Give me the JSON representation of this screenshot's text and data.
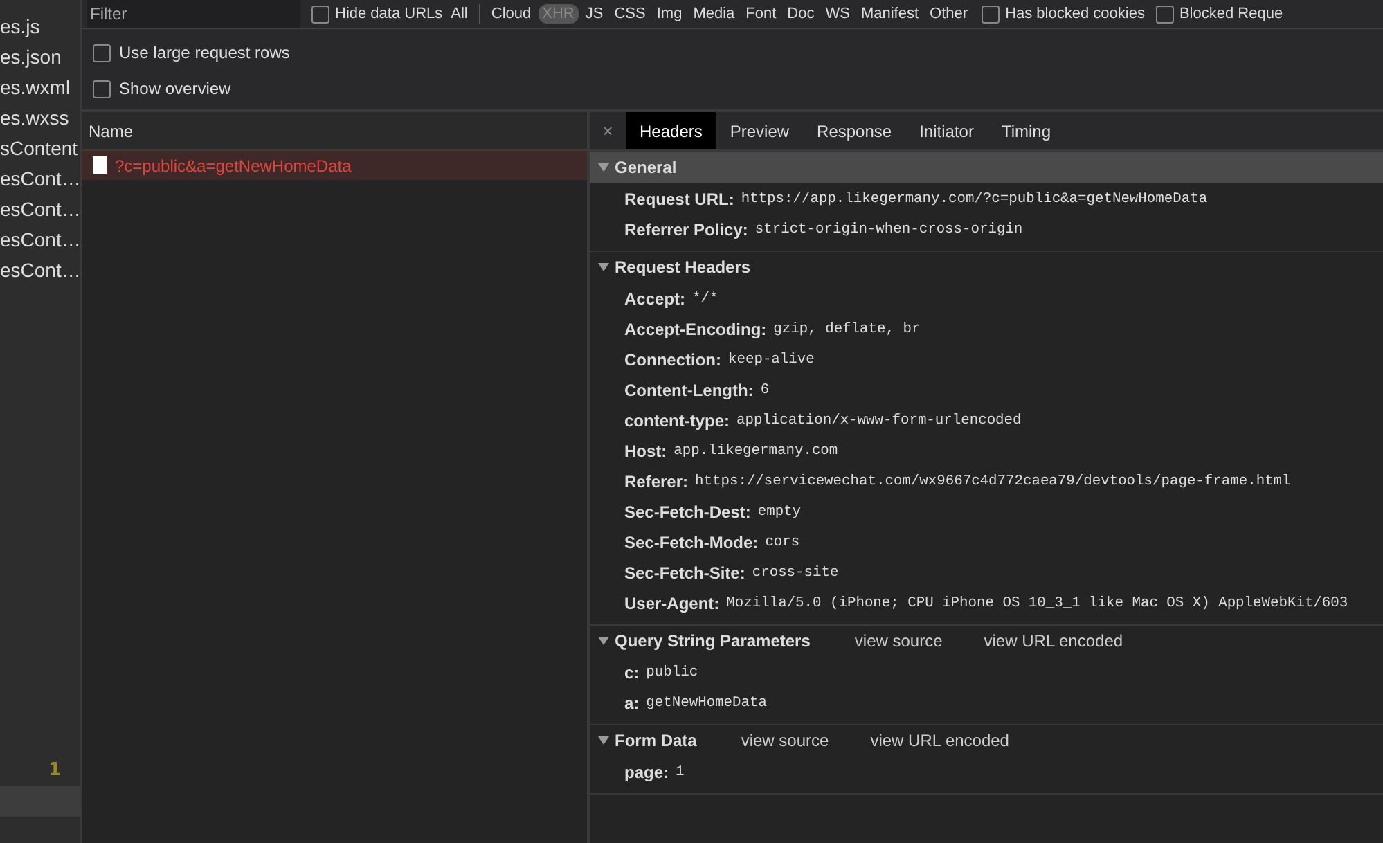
{
  "files": [
    "es.js",
    "es.json",
    "es.wxml",
    "es.wxss",
    "sContent",
    "esCont…",
    "esCont…",
    "esCont…",
    "esCont…"
  ],
  "file_badge": "1",
  "filter": {
    "placeholder": "Filter"
  },
  "hide_data_urls": {
    "label": "Hide data URLs",
    "checked": false
  },
  "types": [
    {
      "label": "All",
      "selected": false
    },
    {
      "label": "Cloud",
      "selected": false
    },
    {
      "label": "XHR",
      "selected": true
    },
    {
      "label": "JS",
      "selected": false
    },
    {
      "label": "CSS",
      "selected": false
    },
    {
      "label": "Img",
      "selected": false
    },
    {
      "label": "Media",
      "selected": false
    },
    {
      "label": "Font",
      "selected": false
    },
    {
      "label": "Doc",
      "selected": false
    },
    {
      "label": "WS",
      "selected": false
    },
    {
      "label": "Manifest",
      "selected": false
    },
    {
      "label": "Other",
      "selected": false
    }
  ],
  "right_checks": [
    {
      "label": "Has blocked cookies",
      "checked": false
    },
    {
      "label": "Blocked Reque",
      "checked": false
    }
  ],
  "options": [
    {
      "label": "Use large request rows",
      "checked": false
    },
    {
      "label": "Show overview",
      "checked": false
    }
  ],
  "requests": {
    "column": "Name",
    "rows": [
      {
        "name": "?c=public&a=getNewHomeData",
        "selected": true
      }
    ]
  },
  "detail_tabs": {
    "close": "×",
    "tabs": [
      {
        "label": "Headers",
        "selected": true
      },
      {
        "label": "Preview",
        "selected": false
      },
      {
        "label": "Response",
        "selected": false
      },
      {
        "label": "Initiator",
        "selected": false
      },
      {
        "label": "Timing",
        "selected": false
      }
    ]
  },
  "sections": [
    {
      "title": "General",
      "expanded": true,
      "highlight": true,
      "entries": [
        {
          "key": "Request URL:",
          "value": "https://app.likegermany.com/?c=public&a=getNewHomeData"
        },
        {
          "key": "Referrer Policy:",
          "value": "strict-origin-when-cross-origin"
        }
      ]
    },
    {
      "title": "Request Headers",
      "expanded": true,
      "highlight": false,
      "entries": [
        {
          "key": "Accept:",
          "value": "*/*"
        },
        {
          "key": "Accept-Encoding:",
          "value": "gzip, deflate, br"
        },
        {
          "key": "Connection:",
          "value": "keep-alive"
        },
        {
          "key": "Content-Length:",
          "value": "6"
        },
        {
          "key": "content-type:",
          "value": "application/x-www-form-urlencoded"
        },
        {
          "key": "Host:",
          "value": "app.likegermany.com"
        },
        {
          "key": "Referer:",
          "value": "https://servicewechat.com/wx9667c4d772caea79/devtools/page-frame.html"
        },
        {
          "key": "Sec-Fetch-Dest:",
          "value": "empty"
        },
        {
          "key": "Sec-Fetch-Mode:",
          "value": "cors"
        },
        {
          "key": "Sec-Fetch-Site:",
          "value": "cross-site"
        },
        {
          "key": "User-Agent:",
          "value": "Mozilla/5.0 (iPhone; CPU iPhone OS 10_3_1 like Mac OS X) AppleWebKit/603"
        }
      ]
    },
    {
      "title": "Query String Parameters",
      "expanded": true,
      "highlight": false,
      "links": [
        "view source",
        "view URL encoded"
      ],
      "entries": [
        {
          "key": "c:",
          "value": "public"
        },
        {
          "key": "a:",
          "value": "getNewHomeData"
        }
      ]
    },
    {
      "title": "Form Data",
      "expanded": true,
      "highlight": false,
      "links": [
        "view source",
        "view URL encoded"
      ],
      "entries": [
        {
          "key": "page:",
          "value": "1"
        }
      ]
    }
  ]
}
